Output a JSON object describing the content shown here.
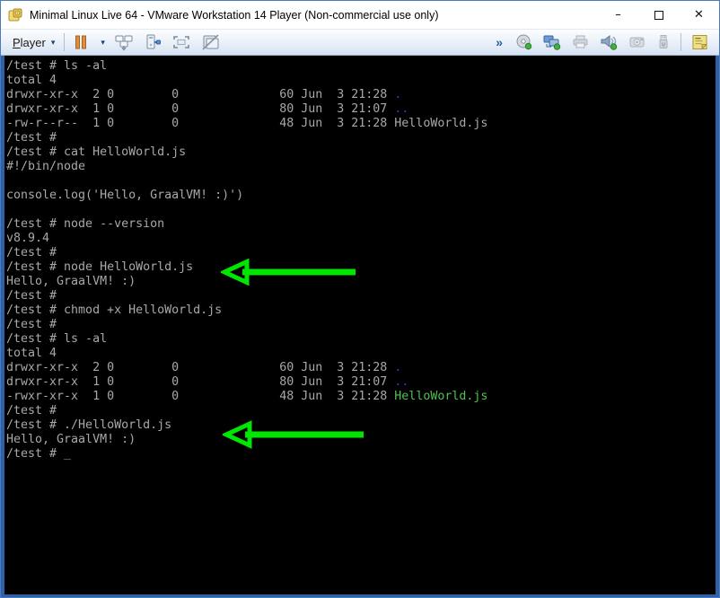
{
  "window": {
    "title": "Minimal Linux Live 64 - VMware Workstation 14 Player (Non-commercial use only)",
    "minimize_glyph": "–",
    "close_glyph": "✕"
  },
  "toolbar": {
    "player_first": "P",
    "player_rest": "layer",
    "player_caret": "▾",
    "suspend_caret": "▾",
    "expand_chevron": "»",
    "icon_names": {
      "left": [
        "suspend-pause-icon",
        "ctrl-alt-del-icon",
        "manage-device-icon",
        "fullscreen-icon",
        "unity-icon"
      ],
      "right": [
        "cd-dvd-icon",
        "network-adapter-icon",
        "printer-icon",
        "sound-icon",
        "webcam-icon",
        "usb-icon",
        "notes-panel-icon"
      ]
    }
  },
  "terminal": {
    "lines": [
      [
        [
          "/test # ls -al",
          ""
        ]
      ],
      [
        [
          "total 4",
          ""
        ]
      ],
      [
        [
          "drwxr-xr-x  2 0        0              60 Jun  3 21:28 ",
          ""
        ],
        [
          ".",
          "dir"
        ]
      ],
      [
        [
          "drwxr-xr-x  1 0        0              80 Jun  3 21:07 ",
          ""
        ],
        [
          "..",
          "dir"
        ]
      ],
      [
        [
          "-rw-r--r--  1 0        0              48 Jun  3 21:28 HelloWorld.js",
          ""
        ]
      ],
      [
        [
          "/test #",
          ""
        ]
      ],
      [
        [
          "/test # cat HelloWorld.js",
          ""
        ]
      ],
      [
        [
          "#!/bin/node",
          ""
        ]
      ],
      [],
      [
        [
          "console.log('Hello, GraalVM! :)')",
          ""
        ]
      ],
      [],
      [
        [
          "/test # node --version",
          ""
        ]
      ],
      [
        [
          "v8.9.4",
          ""
        ]
      ],
      [
        [
          "/test #",
          ""
        ]
      ],
      [
        [
          "/test # node HelloWorld.js",
          ""
        ]
      ],
      [
        [
          "Hello, GraalVM! :)",
          ""
        ]
      ],
      [
        [
          "/test #",
          ""
        ]
      ],
      [
        [
          "/test # chmod +x HelloWorld.js",
          ""
        ]
      ],
      [
        [
          "/test #",
          ""
        ]
      ],
      [
        [
          "/test # ls -al",
          ""
        ]
      ],
      [
        [
          "total 4",
          ""
        ]
      ],
      [
        [
          "drwxr-xr-x  2 0        0              60 Jun  3 21:28 ",
          ""
        ],
        [
          ".",
          "dir"
        ]
      ],
      [
        [
          "drwxr-xr-x  1 0        0              80 Jun  3 21:07 ",
          ""
        ],
        [
          "..",
          "dir"
        ]
      ],
      [
        [
          "-rwxr-xr-x  1 0        0              48 Jun  3 21:28 ",
          ""
        ],
        [
          "HelloWorld.js",
          "exec"
        ]
      ],
      [
        [
          "/test #",
          ""
        ]
      ],
      [
        [
          "/test # ./HelloWorld.js",
          ""
        ]
      ],
      [
        [
          "Hello, GraalVM! :)",
          ""
        ]
      ],
      [
        [
          "/test # _",
          ""
        ]
      ]
    ]
  },
  "colors": {
    "window-border": "#4d7ab8",
    "terminal-border": "#2e62a8",
    "titlebar-bg": "#ffffff",
    "term-fg": "#a8a8a8",
    "term-dir": "#3737cf",
    "term-exec": "#4fc04f",
    "arrow-green": "#00e600",
    "suspend-orange": "#dd8f3d",
    "accent-blue": "#2a5db0"
  }
}
